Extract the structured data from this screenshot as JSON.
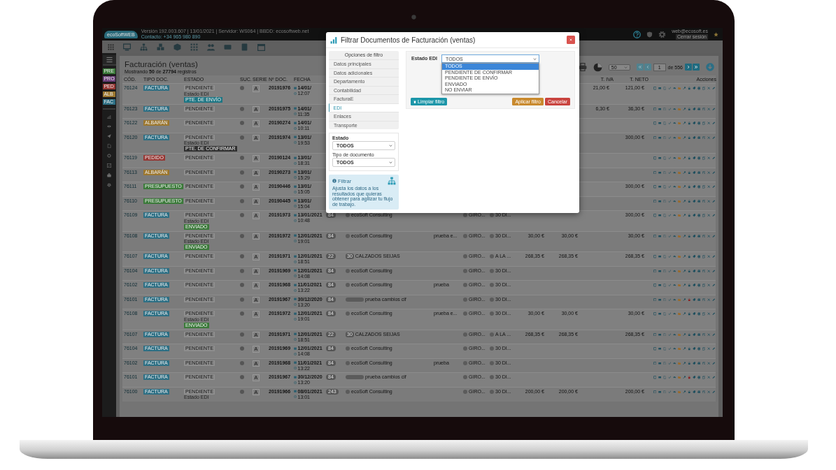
{
  "app": {
    "logo": "ecoSoftWEB",
    "version": "Versión 192.003.607 | 13/01/2021 | Servidor: WS064 | BBDD: ecosoftweb.net",
    "contact": "Contacto: +34 965 980 890",
    "user": "web@ecosoft.es",
    "logout": "Cerrar sesión"
  },
  "sidebar": {
    "tags": [
      {
        "label": "PRE",
        "color": "#3b7a3a"
      },
      {
        "label": "PRO",
        "color": "#6a3d78"
      },
      {
        "label": "PED",
        "color": "#963734"
      },
      {
        "label": "ALB",
        "color": "#9c772f"
      },
      {
        "label": "FAC",
        "color": "#2d6f84"
      }
    ]
  },
  "page": {
    "title": "Facturación (ventas)",
    "subtitle": "Mostrando **50** de **27794** registros",
    "page_size": "50",
    "page": "1",
    "page_total": "de 556"
  },
  "table": {
    "columns": [
      {
        "kind": "cod",
        "label": "CÓD."
      },
      {
        "kind": "tipo",
        "label": "TIPO DOC."
      },
      {
        "kind": "estado",
        "label": "ESTADO"
      },
      {
        "kind": "suc",
        "label": "SUC."
      },
      {
        "kind": "serie",
        "label": "SERIE"
      },
      {
        "kind": "num",
        "label": "Nº DOC."
      },
      {
        "kind": "fecha",
        "label": "FECHA"
      },
      {
        "kind": "a3",
        "label": "T. IVA"
      },
      {
        "kind": "a4",
        "label": "T. NETO"
      },
      {
        "kind": "acciones",
        "label": "Acciones"
      }
    ],
    "rows": [
      {
        "cod": "76124",
        "tipo": {
          "label": "FACTURA",
          "color": "#2d6f84"
        },
        "estado": "PENDIENTE",
        "edi": {
          "label": "Estado EDI",
          "badge": "PTE. DE ENVÍO",
          "color": "#1d7684"
        },
        "serie": "A",
        "num": "20191976",
        "date": "14/01/",
        "time": "12:07",
        "a3": "21,00 €",
        "a4": "121,00 €",
        "blocked": false
      },
      {
        "cod": "76123",
        "tipo": {
          "label": "FACTURA",
          "color": "#2d6f84"
        },
        "estado": "PENDIENTE",
        "serie": "A",
        "num": "20191975",
        "date": "14/01/",
        "time": "11:35",
        "a3": "6,30 €",
        "a4": "36,30 €",
        "blocked": false
      },
      {
        "cod": "76122",
        "tipo": {
          "label": "ALBARÁN",
          "color": "#9c772f"
        },
        "estado": "PENDIENTE",
        "serie": "A",
        "num": "20190274",
        "date": "14/01/",
        "time": "10:11",
        "blocked": false
      },
      {
        "cod": "76120",
        "tipo": {
          "label": "FACTURA",
          "color": "#2d6f84"
        },
        "estado": "PENDIENTE",
        "edi": {
          "label": "Estado EDI",
          "badge": "PTE. DE CONFIRMAR",
          "color": "#303030"
        },
        "serie": "A",
        "num": "20191974",
        "date": "13/01/",
        "time": "19:53",
        "a4": "300,00 €",
        "blocked": false
      },
      {
        "cod": "76119",
        "tipo": {
          "label": "PEDIDO",
          "color": "#963734"
        },
        "estado": "PENDIENTE",
        "serie": "A",
        "num": "20190124",
        "date": "13/01/",
        "time": "18:31",
        "blocked": false
      },
      {
        "cod": "76113",
        "tipo": {
          "label": "ALBARÁN",
          "color": "#9c772f"
        },
        "estado": "PENDIENTE",
        "serie": "A",
        "num": "20190273",
        "date": "13/01/",
        "time": "15:29",
        "blocked": false
      },
      {
        "cod": "76111",
        "tipo": {
          "label": "PRESUPUESTO",
          "color": "#3b7a3a"
        },
        "estado": "PENDIENTE",
        "serie": "A",
        "num": "20190446",
        "date": "13/01/",
        "time": "15:05",
        "a4": "300,00 €",
        "blocked": false
      },
      {
        "cod": "76110",
        "tipo": {
          "label": "PRESUPUESTO",
          "color": "#3b7a3a"
        },
        "estado": "PENDIENTE",
        "serie": "A",
        "num": "20190445",
        "date": "13/01/",
        "time": "15:04",
        "blocked": false
      },
      {
        "cod": "76109",
        "tipo": {
          "label": "FACTURA",
          "color": "#2d6f84"
        },
        "estado": "PENDIENTE",
        "edi": {
          "label": "Estado EDI",
          "badge": "ENVIADO",
          "color": "#3b7a3a"
        },
        "serie": "A",
        "num": "20191973",
        "date": "13/01/2021",
        "time": "10:48",
        "count": "84",
        "client": {
          "name": "ecoSoft Consulting",
          "kind": "dot"
        },
        "pago1": "GIRO...",
        "pago2": "30 DI...",
        "a4": "300,00 €",
        "blocked": false
      },
      {
        "cod": "76108",
        "tipo": {
          "label": "FACTURA",
          "color": "#2d6f84"
        },
        "estado": "PENDIENTE",
        "edi": {
          "label": "Estado EDI",
          "badge": "ENVIADO",
          "color": "#3b7a3a"
        },
        "serie": "A",
        "num": "20191972",
        "date": "12/01/2021",
        "time": "19:01",
        "count": "84",
        "client": {
          "name": "ecoSoft Consulting",
          "kind": "dot"
        },
        "obs": "prueba e...",
        "pago1": "GIRO...",
        "pago2": "30 DI...",
        "a1": "30,00 €",
        "a2": "30,00 €",
        "a4": "30,00 €",
        "blocked": false
      },
      {
        "cod": "76107",
        "tipo": {
          "label": "FACTURA",
          "color": "#2d6f84"
        },
        "estado": "PENDIENTE",
        "serie": "A",
        "num": "20191971",
        "date": "12/01/2021",
        "time": "18:51",
        "count": "22",
        "client": {
          "name": "CALZADOS SEIJAS",
          "kind": "number",
          "badge": "30"
        },
        "pago1": "GIRO...",
        "pago2": "A LA ...",
        "a1": "268,35 €",
        "a2": "268,35 €",
        "a4": "268,35 €",
        "blocked": false
      },
      {
        "cod": "76104",
        "tipo": {
          "label": "FACTURA",
          "color": "#2d6f84"
        },
        "estado": "PENDIENTE",
        "serie": "A",
        "num": "20191969",
        "date": "12/01/2021",
        "time": "14:08",
        "count": "84",
        "client": {
          "name": "ecoSoft Consulting",
          "kind": "dot"
        },
        "pago1": "GIRO...",
        "pago2": "30 DI...",
        "blocked": false
      },
      {
        "cod": "76102",
        "tipo": {
          "label": "FACTURA",
          "color": "#2d6f84"
        },
        "estado": "PENDIENTE",
        "serie": "A",
        "num": "20191968",
        "date": "11/01/2021",
        "time": "13:22",
        "count": "84",
        "client": {
          "name": "ecoSoft Consulting",
          "kind": "dot"
        },
        "obs": "prueba",
        "pago1": "GIRO...",
        "pago2": "30 DI...",
        "blocked": false
      },
      {
        "cod": "76101",
        "tipo": {
          "label": "FACTURA",
          "color": "#2d6f84"
        },
        "estado": "PENDIENTE",
        "serie": "A",
        "num": "20191967",
        "date": "30/12/2020",
        "time": "13:20",
        "count": "84",
        "client": {
          "name": "prueba cambios cif",
          "kind": "wide"
        },
        "pago1": "GIRO...",
        "pago2": "30 DI...",
        "blocked": true
      },
      {
        "cod": "76108",
        "tipo": {
          "label": "FACTURA",
          "color": "#2d6f84"
        },
        "estado": "PENDIENTE",
        "edi": {
          "label": "Estado EDI",
          "badge": "ENVIADO",
          "color": "#3b7a3a"
        },
        "serie": "A",
        "num": "20191972",
        "date": "12/01/2021",
        "time": "19:01",
        "count": "84",
        "client": {
          "name": "ecoSoft Consulting",
          "kind": "dot"
        },
        "obs": "prueba e...",
        "pago1": "GIRO...",
        "pago2": "30 DI...",
        "a1": "30,00 €",
        "a2": "30,00 €",
        "a4": "30,00 €",
        "blocked": false
      },
      {
        "cod": "76107",
        "tipo": {
          "label": "FACTURA",
          "color": "#2d6f84"
        },
        "estado": "PENDIENTE",
        "serie": "A",
        "num": "20191971",
        "date": "12/01/2021",
        "time": "18:51",
        "count": "22",
        "client": {
          "name": "CALZADOS SEIJAS",
          "kind": "number",
          "badge": "30"
        },
        "pago1": "GIRO...",
        "pago2": "A LA ...",
        "a1": "268,35 €",
        "a2": "268,35 €",
        "a4": "268,35 €",
        "blocked": false
      },
      {
        "cod": "76104",
        "tipo": {
          "label": "FACTURA",
          "color": "#2d6f84"
        },
        "estado": "PENDIENTE",
        "serie": "A",
        "num": "20191969",
        "date": "12/01/2021",
        "time": "14:08",
        "count": "84",
        "client": {
          "name": "ecoSoft Consulting",
          "kind": "dot"
        },
        "pago1": "GIRO...",
        "pago2": "30 DI...",
        "blocked": false
      },
      {
        "cod": "76102",
        "tipo": {
          "label": "FACTURA",
          "color": "#2d6f84"
        },
        "estado": "PENDIENTE",
        "serie": "A",
        "num": "20191968",
        "date": "11/01/2021",
        "time": "13:22",
        "count": "84",
        "client": {
          "name": "ecoSoft Consulting",
          "kind": "dot"
        },
        "obs": "prueba",
        "pago1": "GIRO...",
        "pago2": "30 DI...",
        "blocked": false
      },
      {
        "cod": "76101",
        "tipo": {
          "label": "FACTURA",
          "color": "#2d6f84"
        },
        "estado": "PENDIENTE",
        "serie": "A",
        "num": "20191967",
        "date": "30/12/2020",
        "time": "13:20",
        "count": "84",
        "client": {
          "name": "prueba cambios cif",
          "kind": "wide"
        },
        "pago1": "GIRO...",
        "pago2": "30 DI...",
        "blocked": true
      },
      {
        "cod": "76100",
        "tipo": {
          "label": "FACTURA",
          "color": "#2d6f84"
        },
        "estado": "PENDIENTE",
        "edi": {
          "label": "Estado EDI"
        },
        "serie": "A",
        "num": "20191966",
        "date": "08/01/2021",
        "time": "13:01",
        "count": "243",
        "client": {
          "name": "ecoSoft Consulting",
          "kind": "dot"
        },
        "pago1": "GIRO...",
        "pago2": "30 DI...",
        "a1": "200,00 €",
        "a2": "200,00 €",
        "a4": "200,00 €",
        "blocked": false
      }
    ]
  },
  "modal": {
    "title": "Filtrar Documentos de Facturación (ventas)",
    "nav": {
      "heading": "Opciones de filtro",
      "items": [
        {
          "label": "Datos principales",
          "selected": false
        },
        {
          "label": "Datos adicionales",
          "selected": false
        },
        {
          "label": "Departamento",
          "selected": false
        },
        {
          "label": "Contabilidad",
          "selected": false
        },
        {
          "label": "FacturaE",
          "selected": false
        },
        {
          "label": "EDI",
          "selected": true
        },
        {
          "label": "Enlaces",
          "selected": false
        },
        {
          "label": "Transporte",
          "selected": false
        }
      ]
    },
    "filters": [
      {
        "label": "Estado",
        "value": "TODOS"
      },
      {
        "label": "Tipo de documento",
        "value": "TODOS"
      }
    ],
    "info": {
      "title": "Filtrar",
      "text": "Ajusta los datos a los resultados que quieras obtener para agilizar tu flujo de trabajo."
    },
    "edi": {
      "label": "Estado EDI",
      "value": "TODOS",
      "expanded": true,
      "options": [
        {
          "label": "TODOS",
          "selected": true
        },
        {
          "label": "PENDIENTE DE CONFIRMAR",
          "selected": false
        },
        {
          "label": "PENDIENTE DE ENVÍO",
          "selected": false
        },
        {
          "label": "ENVIADO",
          "selected": false
        },
        {
          "label": "NO ENVIAR",
          "selected": false
        }
      ]
    },
    "buttons": [
      {
        "label": "Limpiar filtro",
        "kind": "clear"
      },
      {
        "label": "Aplicar filtro",
        "kind": "apply"
      },
      {
        "label": "Cancelar",
        "kind": "cancel"
      }
    ]
  }
}
